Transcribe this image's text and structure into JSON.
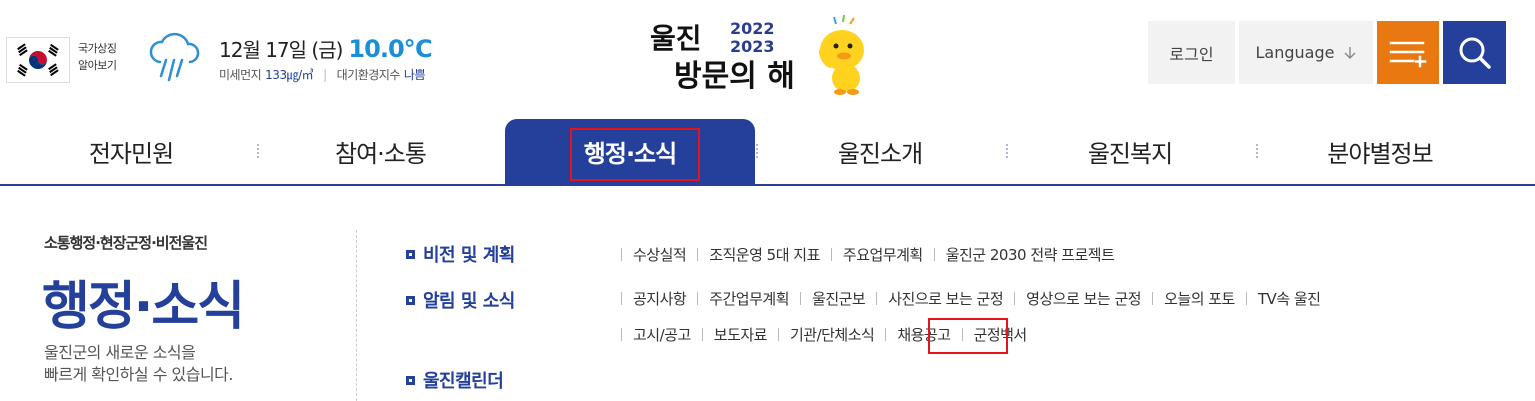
{
  "header": {
    "flag_label_line1": "국가상징",
    "flag_label_line2": "알아보기",
    "date": "12월 17일 (금)",
    "temperature": "10.0℃",
    "dust_label": "미세먼지",
    "dust_value": "133㎍/㎥",
    "air_label": "대기환경지수",
    "air_value": "나쁨",
    "logo": {
      "text_line1": "울진",
      "text_line2": "방문의 해",
      "years_line1": "2022",
      "years_line2": "2023"
    },
    "login_label": "로그인",
    "language_label": "Language",
    "menu_icon": "menu-plus-icon",
    "search_icon": "search-icon"
  },
  "gnb": {
    "items": [
      {
        "label": "전자민원"
      },
      {
        "label": "참여·소통"
      },
      {
        "label": "행정·소식"
      },
      {
        "label": "울진소개"
      },
      {
        "label": "울진복지"
      },
      {
        "label": "분야별정보"
      }
    ],
    "active_index": 2
  },
  "submenu": {
    "kicker": "소통행정·현장군정·비전울진",
    "title": "행정·소식",
    "desc_line1": "울진군의 새로운 소식을",
    "desc_line2": "빠르게 확인하실 수 있습니다.",
    "categories": [
      {
        "label": "비전 및 계획",
        "links": [
          "수상실적",
          "조직운영 5대 지표",
          "주요업무계획",
          "울진군 2030 전략 프로젝트"
        ]
      },
      {
        "label": "알림 및 소식",
        "links": [
          "공지사항",
          "주간업무계획",
          "울진군보",
          "사진으로 보는 군정",
          "영상으로 보는 군정",
          "오늘의 포토",
          "TV속 울진"
        ],
        "links2": [
          "고시/공고",
          "보도자료",
          "기관/단체소식",
          "채용공고",
          "군정백서"
        ]
      },
      {
        "label": "울진캘린더"
      }
    ]
  },
  "colors": {
    "primary": "#24409a",
    "accent_orange": "#e8780f",
    "highlight_red": "#e4141c",
    "temperature": "#1a8fd8"
  }
}
